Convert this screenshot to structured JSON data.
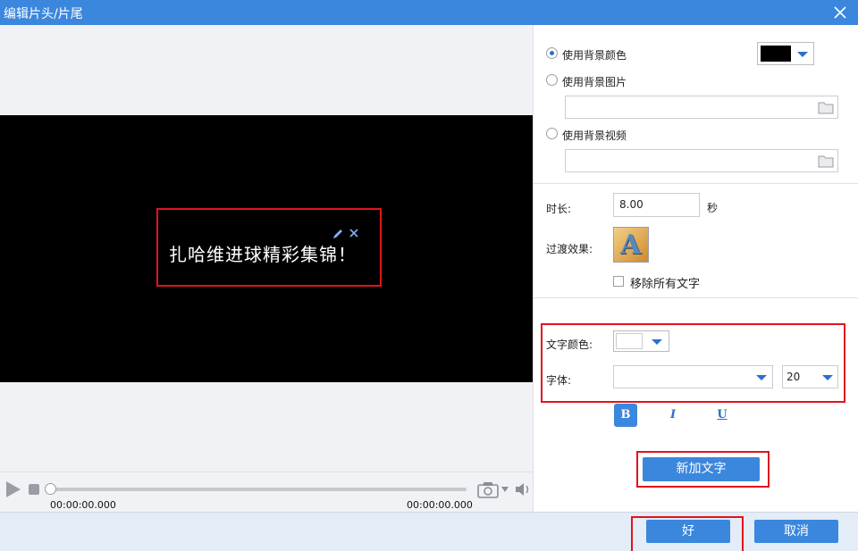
{
  "window": {
    "title": "编辑片头/片尾"
  },
  "preview": {
    "caption": "扎哈维进球精彩集锦！"
  },
  "player": {
    "time_start": "00:00:00.000",
    "time_end": "00:00:00.000"
  },
  "background": {
    "options": [
      {
        "label": "使用背景颜色",
        "selected": true
      },
      {
        "label": "使用背景图片",
        "selected": false
      },
      {
        "label": "使用背景视频",
        "selected": false
      }
    ],
    "color": "#000000"
  },
  "duration": {
    "label": "时长:",
    "value": "8.00",
    "unit": "秒"
  },
  "transition": {
    "label": "过渡效果:"
  },
  "remove_text": {
    "label": "移除所有文字",
    "checked": false
  },
  "text_style": {
    "color_label": "文字颜色:",
    "color": "#ffffff",
    "font_label": "字体:",
    "font_value": "",
    "size_value": "20",
    "bold_label": "B",
    "italic_label": "I",
    "underline_label": "U"
  },
  "add_text_button": "新加文字",
  "footer": {
    "ok_label": "好",
    "cancel_label": "取消"
  },
  "colors": {
    "accent": "#3b87dd",
    "highlight": "#e0141e",
    "title_bar": "#3b87dd"
  }
}
